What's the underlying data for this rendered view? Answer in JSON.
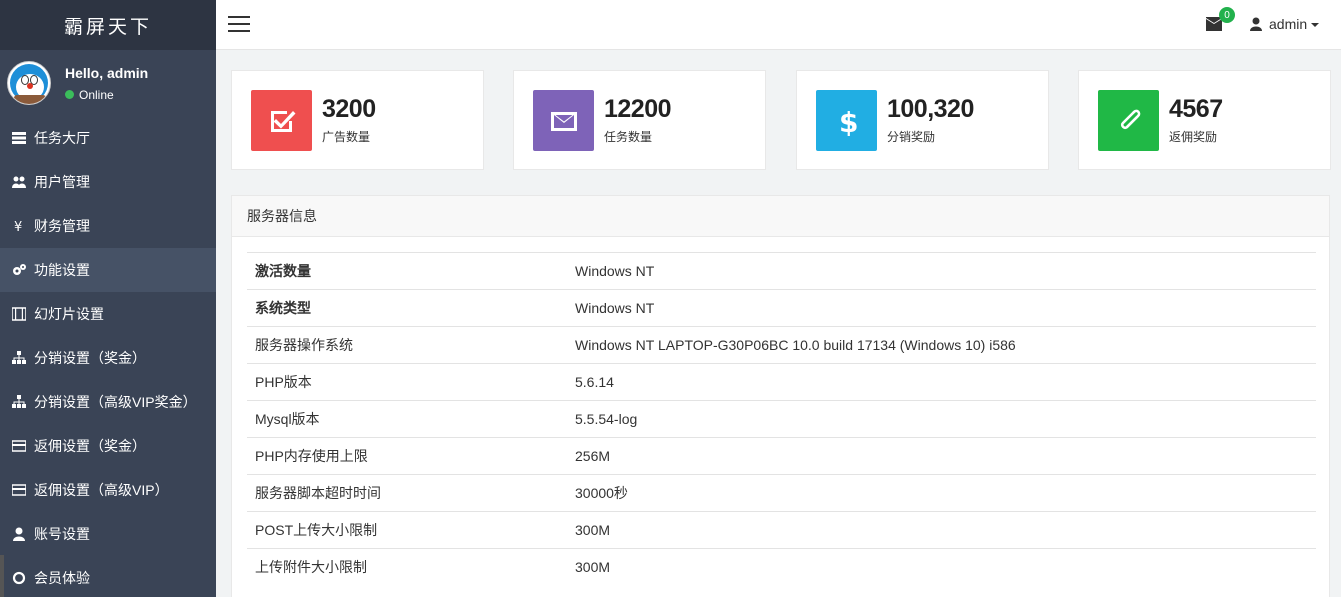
{
  "sidebar": {
    "brand": "霸屏天下",
    "user": {
      "greeting": "Hello, admin",
      "status": "Online"
    },
    "items": [
      {
        "label": "任务大厅",
        "icon": "list-icon"
      },
      {
        "label": "用户管理",
        "icon": "users-icon"
      },
      {
        "label": "财务管理",
        "icon": "yen-icon"
      },
      {
        "label": "功能设置",
        "icon": "gears-icon"
      },
      {
        "label": "幻灯片设置",
        "icon": "film-icon"
      },
      {
        "label": "分销设置（奖金）",
        "icon": "sitemap-icon"
      },
      {
        "label": "分销设置（高级VIP奖金）",
        "icon": "sitemap-icon"
      },
      {
        "label": "返佣设置（奖金）",
        "icon": "credit-card-icon"
      },
      {
        "label": "返佣设置（高级VIP）",
        "icon": "credit-card-icon"
      },
      {
        "label": "账号设置",
        "icon": "user-icon"
      },
      {
        "label": "会员体验",
        "icon": "circle-icon"
      }
    ],
    "active_index": 3
  },
  "topbar": {
    "mail_count": "0",
    "username": "admin"
  },
  "stats": [
    {
      "value": "3200",
      "label": "广告数量",
      "color": "#ef4f4f",
      "icon": "check-square-icon"
    },
    {
      "value": "12200",
      "label": "任务数量",
      "color": "#7e63b8",
      "icon": "envelope-icon"
    },
    {
      "value": "100,320",
      "label": "分销奖励",
      "color": "#21aee3",
      "icon": "dollar-icon"
    },
    {
      "value": "4567",
      "label": "返佣奖励",
      "color": "#20b846",
      "icon": "paperclip-icon"
    }
  ],
  "server": {
    "title": "服务器信息",
    "rows": [
      {
        "key": "激活数量",
        "value": "Windows NT",
        "bold": true
      },
      {
        "key": "系统类型",
        "value": "Windows NT",
        "bold": true
      },
      {
        "key": "服务器操作系统",
        "value": "Windows NT LAPTOP-G30P06BC 10.0 build 17134 (Windows 10) i586",
        "bold": false
      },
      {
        "key": "PHP版本",
        "value": "5.6.14",
        "bold": false
      },
      {
        "key": "Mysql版本",
        "value": "5.5.54-log",
        "bold": false
      },
      {
        "key": "PHP内存使用上限",
        "value": "256M",
        "bold": false
      },
      {
        "key": "服务器脚本超时时间",
        "value": "30000秒",
        "bold": false
      },
      {
        "key": "POST上传大小限制",
        "value": "300M",
        "bold": false
      },
      {
        "key": "上传附件大小限制",
        "value": "300M",
        "bold": false
      }
    ]
  }
}
